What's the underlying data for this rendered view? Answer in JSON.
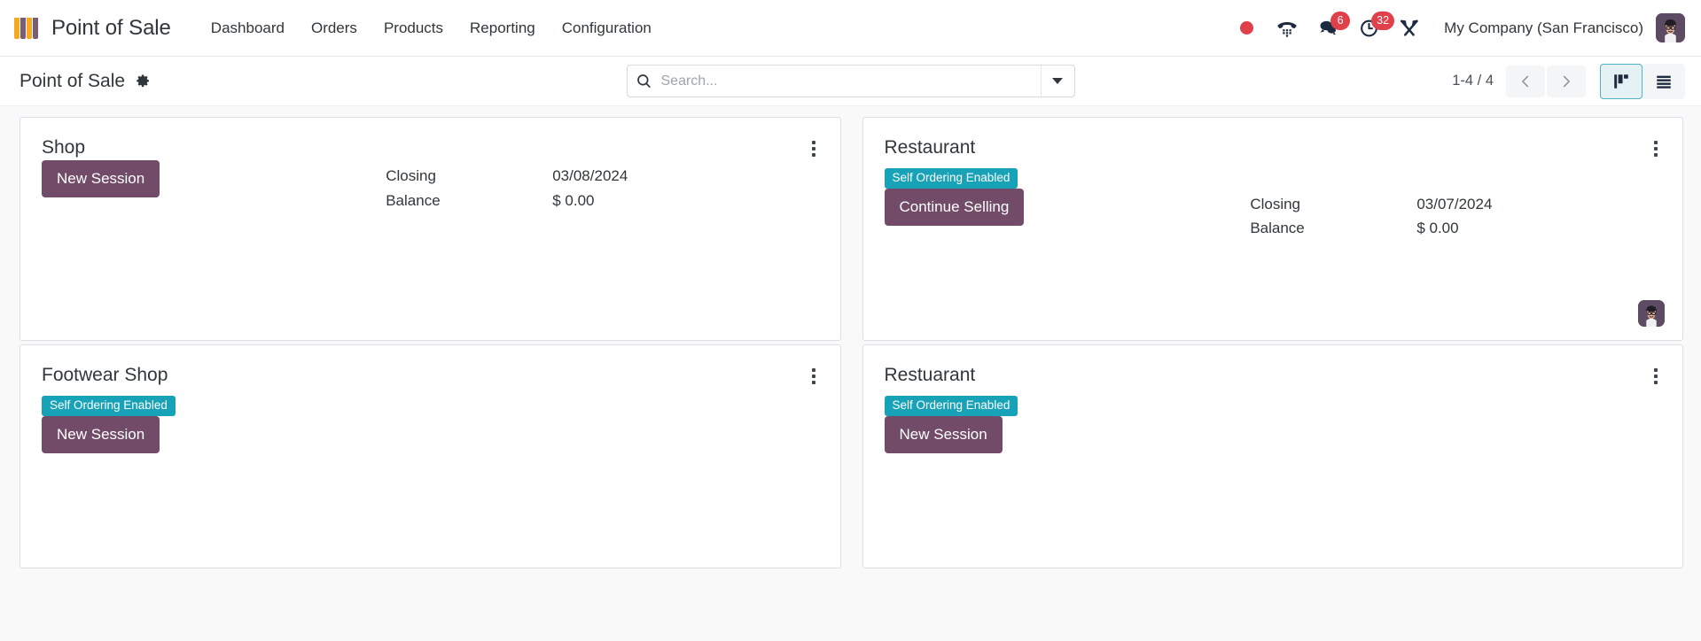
{
  "navbar": {
    "logo_icon": "pos-awning-icon",
    "brand": "Point of Sale",
    "menu": [
      {
        "label": "Dashboard",
        "name": "dashboard"
      },
      {
        "label": "Orders",
        "name": "orders"
      },
      {
        "label": "Products",
        "name": "products"
      },
      {
        "label": "Reporting",
        "name": "reporting"
      },
      {
        "label": "Configuration",
        "name": "configuration"
      }
    ],
    "systray": {
      "recording_icon": "record-dot-icon",
      "phone_icon": "phone-dialpad-icon",
      "messages_icon": "chat-bubbles-icon",
      "messages_count": "6",
      "activities_icon": "clock-activities-icon",
      "activities_count": "32",
      "tools_icon": "tools-wrench-screwdriver-icon",
      "company": "My Company (San Francisco)",
      "avatar_icon": "user-avatar"
    }
  },
  "control_panel": {
    "breadcrumb": "Point of Sale",
    "settings_icon": "gear-icon",
    "search": {
      "icon": "search-icon",
      "placeholder": "Search...",
      "value": "",
      "toggle_icon": "chevron-down-icon"
    },
    "pager": {
      "count": "1-4 / 4",
      "prev_icon": "chevron-left-icon",
      "next_icon": "chevron-right-icon"
    },
    "views": {
      "kanban_icon": "kanban-view-icon",
      "kanban_active": true,
      "list_icon": "list-view-icon",
      "list_active": false
    }
  },
  "kanban": {
    "balance_labels": {
      "line1": "Closing",
      "line2": "Balance"
    },
    "menu_icon": "kebab-menu-icon",
    "cards": [
      {
        "name": "shop",
        "title": "Shop",
        "badge": null,
        "button": "New Session",
        "closing_date": "03/08/2024",
        "closing_balance": "$ 0.00",
        "has_balance": true,
        "avatar": false
      },
      {
        "name": "restaurant",
        "title": "Restaurant",
        "badge": "Self Ordering Enabled",
        "button": "Continue Selling",
        "closing_date": "03/07/2024",
        "closing_balance": "$ 0.00",
        "has_balance": true,
        "avatar": true
      },
      {
        "name": "footwear-shop",
        "title": "Footwear Shop",
        "badge": "Self Ordering Enabled",
        "button": "New Session",
        "closing_date": null,
        "closing_balance": null,
        "has_balance": false,
        "avatar": false
      },
      {
        "name": "restuarant",
        "title": "Restuarant",
        "badge": "Self Ordering Enabled",
        "button": "New Session",
        "closing_date": null,
        "closing_balance": null,
        "has_balance": false,
        "avatar": false
      }
    ]
  },
  "colors": {
    "primary_purple": "#714b67",
    "badge_teal": "#17a2b8",
    "notification_red": "#e0404a",
    "active_view_border": "#50b3c4",
    "logo_orange": "#f6a823",
    "logo_purple": "#7d5b72"
  }
}
